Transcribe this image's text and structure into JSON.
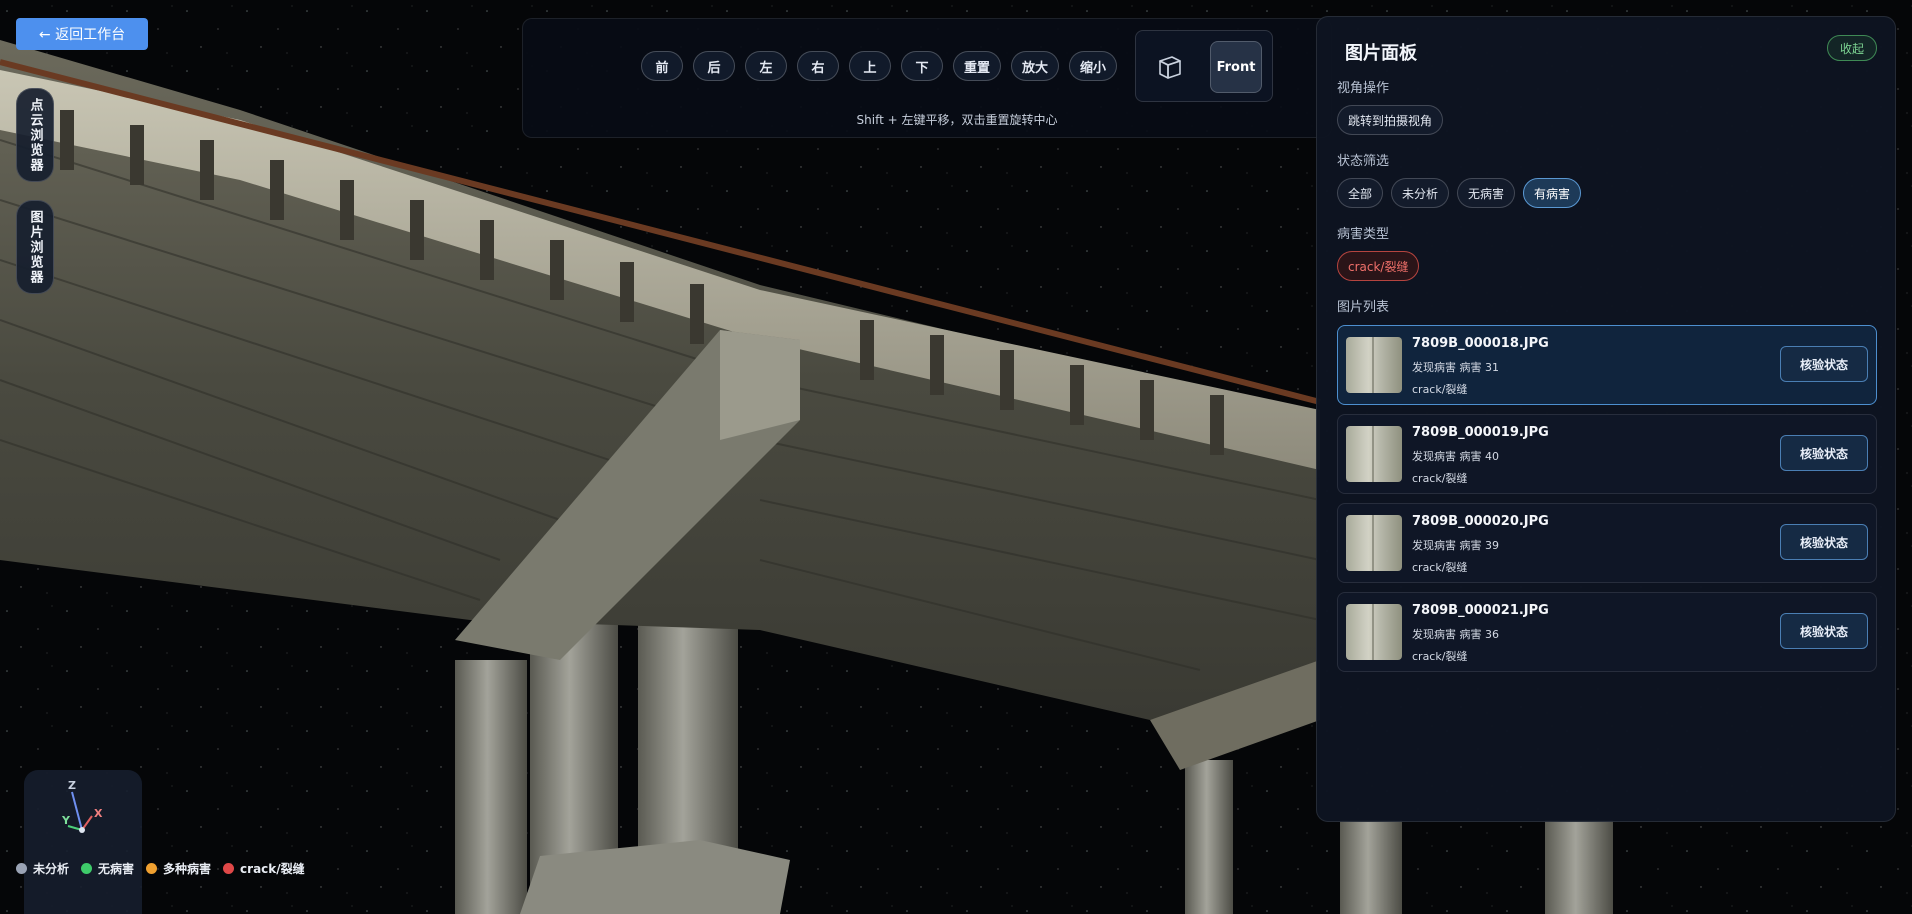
{
  "back_button": {
    "label": "← 返回工作台"
  },
  "side_tabs": [
    {
      "label": "点云浏览器"
    },
    {
      "label": "图片浏览器"
    }
  ],
  "toolbar": {
    "buttons": [
      "前",
      "后",
      "左",
      "右",
      "上",
      "下",
      "重置",
      "放大",
      "缩小"
    ],
    "hint": "Shift + 左键平移，双击重置旋转中心",
    "view_cube": {
      "icon": "cube-icon",
      "current_view": "Front"
    }
  },
  "panel": {
    "title": "图片面板",
    "collapse_label": "收起",
    "sections": {
      "view_ops": {
        "label": "视角操作",
        "button": "跳转到拍摄视角"
      },
      "status_filter": {
        "label": "状态筛选",
        "options": [
          "全部",
          "未分析",
          "无病害",
          "有病害"
        ],
        "selected": "有病害"
      },
      "defect_type": {
        "label": "病害类型",
        "options": [
          "crack/裂缝"
        ]
      },
      "image_list": {
        "label": "图片列表"
      }
    },
    "images": [
      {
        "name": "7809B_000018.JPG",
        "meta": "发现病害  病害 31",
        "tag": "crack/裂缝",
        "action": "核验状态",
        "selected": true
      },
      {
        "name": "7809B_000019.JPG",
        "meta": "发现病害  病害 40",
        "tag": "crack/裂缝",
        "action": "核验状态",
        "selected": false
      },
      {
        "name": "7809B_000020.JPG",
        "meta": "发现病害  病害 39",
        "tag": "crack/裂缝",
        "action": "核验状态",
        "selected": false
      },
      {
        "name": "7809B_000021.JPG",
        "meta": "发现病害  病害 36",
        "tag": "crack/裂缝",
        "action": "核验状态",
        "selected": false
      }
    ]
  },
  "axis_gizmo": {
    "labels": [
      "Z",
      "Y",
      "X"
    ]
  },
  "legend": [
    {
      "label": "未分析",
      "color": "#9aa3b5"
    },
    {
      "label": "无病害",
      "color": "#3ecb6a"
    },
    {
      "label": "多种病害",
      "color": "#f0a030"
    },
    {
      "label": "crack/裂缝",
      "color": "#e04848"
    }
  ]
}
